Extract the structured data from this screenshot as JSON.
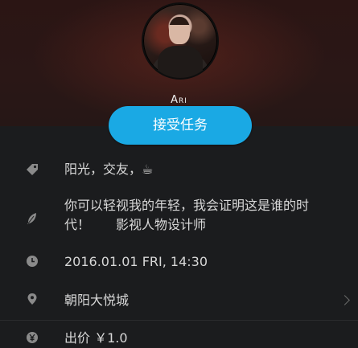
{
  "profile": {
    "username": "Ari",
    "accept_button": "接受任务"
  },
  "details": {
    "tags": "阳光，交友，☕",
    "motto": "你可以轻视我的年轻，我会证明这是谁的时代！　　影视人物设计师",
    "datetime": "2016.01.01 FRI, 14:30",
    "location": "朝阳大悦城",
    "price": "出价 ￥1.0"
  },
  "icons": {
    "tags": "tag-icon",
    "motto": "feather-icon",
    "datetime": "clock-icon",
    "location": "location-pin-icon",
    "price": "yen-icon",
    "location_chevron": "chevron-right-icon"
  },
  "colors": {
    "accent": "#1aa9e4",
    "background": "#1b1c1e",
    "text": "#d8d8d8",
    "icon": "#8a8a8a"
  }
}
